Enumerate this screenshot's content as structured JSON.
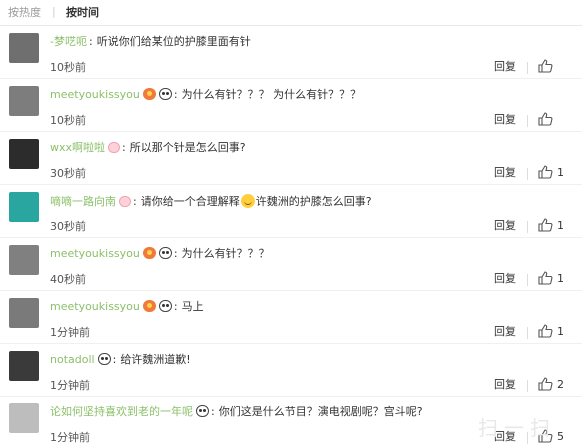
{
  "tabs": {
    "hot": "按热度",
    "separator": "|",
    "time": "按时间"
  },
  "comments": [
    {
      "user": "-梦呓呃",
      "badges": [],
      "text": "听说你们给某位的护膝里面有针",
      "time": "10秒前",
      "reply": "回复",
      "likes": "",
      "avatar": "#6f6f6f"
    },
    {
      "user": "meetyoukissyou",
      "badges": [
        "flag",
        "panda"
      ],
      "text": "为什么有针？？？  为什么有针？？？",
      "time": "10秒前",
      "reply": "回复",
      "likes": "",
      "avatar": "#7d7d7d"
    },
    {
      "user": "wxx啊啦啦",
      "badges": [
        "pig"
      ],
      "text": "所以那个针是怎么回事?",
      "time": "30秒前",
      "reply": "回复",
      "likes": "1",
      "avatar": "#2c2c2c"
    },
    {
      "user": "嘀嘀一路向南",
      "badges": [
        "pig"
      ],
      "text_a": "请你给一个合理解释",
      "text_b": "许魏洲的护膝怎么回事?",
      "time": "30秒前",
      "reply": "回复",
      "likes": "1",
      "avatar": "#2aa6a0"
    },
    {
      "user": "meetyoukissyou",
      "badges": [
        "flag",
        "panda"
      ],
      "text": "为什么有针？？？",
      "time": "40秒前",
      "reply": "回复",
      "likes": "1",
      "avatar": "#808080"
    },
    {
      "user": "meetyoukissyou",
      "badges": [
        "flag",
        "panda"
      ],
      "text": "马上",
      "time": "1分钟前",
      "reply": "回复",
      "likes": "1",
      "avatar": "#7a7a7a"
    },
    {
      "user": "notadoll",
      "badges": [
        "panda"
      ],
      "text": "给许魏洲道歉!",
      "time": "1分钟前",
      "reply": "回复",
      "likes": "2",
      "avatar": "#3a3a3a"
    },
    {
      "user": "论如何坚持喜欢到老的一年呢",
      "badges": [
        "panda"
      ],
      "text": "你们这是什么节目？演电视剧呢？宫斗呢?",
      "time": "1分钟前",
      "reply": "回复",
      "likes": "5",
      "avatar": "#bdbdbd"
    }
  ],
  "watermark": "扫一扫"
}
